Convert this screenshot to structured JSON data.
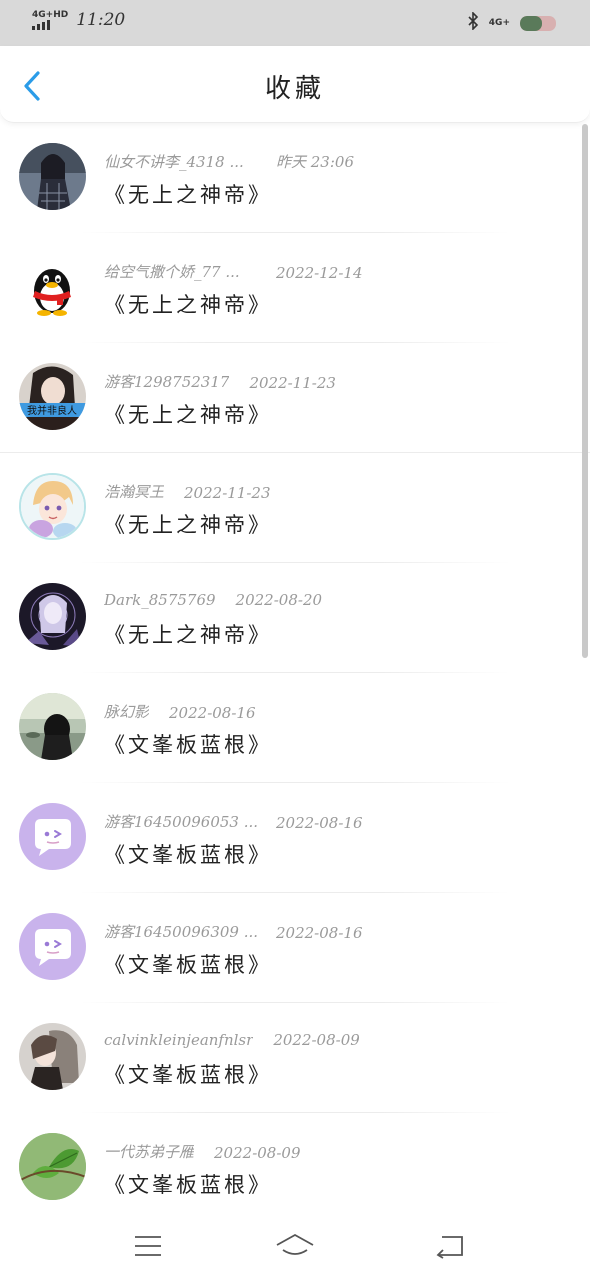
{
  "status_bar": {
    "network_left": "4G+HD",
    "time": "11:20",
    "network_right": "4G+",
    "icons": [
      "signal-icon",
      "bluetooth-icon",
      "battery-icon"
    ]
  },
  "header": {
    "title": "收藏",
    "back_icon": "chevron-left-icon"
  },
  "items": [
    {
      "user": "仙女不讲李_4318 ...",
      "date": "昨天 23:06",
      "book": "《无上之神帝》",
      "avatar": "photo-dark-girl"
    },
    {
      "user": "给空气撒个娇_77 ...",
      "date": "2022-12-14",
      "book": "《无上之神帝》",
      "avatar": "qq-penguin"
    },
    {
      "user": "游客1298752317",
      "date": "2022-11-23",
      "book": "《无上之神帝》",
      "avatar": "photo-girl-caption"
    },
    {
      "user": "浩瀚冥王",
      "date": "2022-11-23",
      "book": "《无上之神帝》",
      "avatar": "anime-boy"
    },
    {
      "user": "Dark_8575769",
      "date": "2022-08-20",
      "book": "《无上之神帝》",
      "avatar": "dark-purple-art"
    },
    {
      "user": "脉幻影",
      "date": "2022-08-16",
      "book": "《文峯板蓝根》",
      "avatar": "photo-girl-back"
    },
    {
      "user": "游客16450096053 ...",
      "date": "2022-08-16",
      "book": "《文峯板蓝根》",
      "avatar": "default-chat-purple"
    },
    {
      "user": "游客16450096309 ...",
      "date": "2022-08-16",
      "book": "《文峯板蓝根》",
      "avatar": "default-chat-purple"
    },
    {
      "user": "calvinkleinjeanfnlsr",
      "date": "2022-08-09",
      "book": "《文峯板蓝根》",
      "avatar": "photo-girl-light"
    },
    {
      "user": "一代苏弟子雁",
      "date": "2022-08-09",
      "book": "《文峯板蓝根》",
      "avatar": "green-leaf"
    }
  ],
  "nav": {
    "menu": "menu-icon",
    "home": "home-icon",
    "back": "back-icon"
  },
  "colors": {
    "accent": "#2b9ce8",
    "status_bg": "#d9d9d9",
    "default_avatar": "#c9b3ec"
  }
}
